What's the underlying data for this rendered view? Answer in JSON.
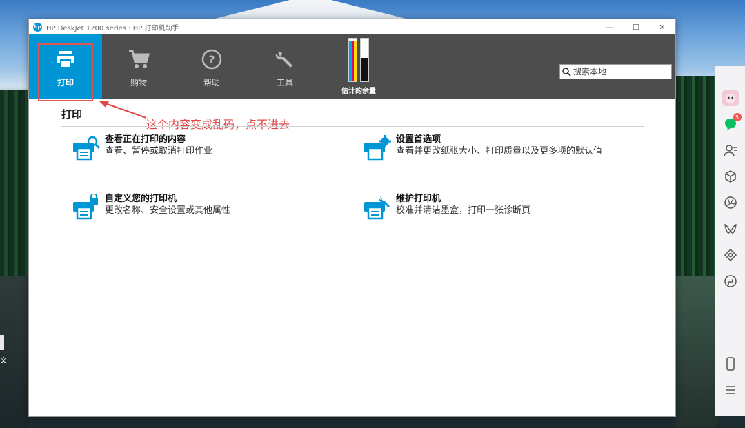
{
  "window": {
    "title": "HP DeskJet 1200 series : HP 打印机助手",
    "logo_text": "hp",
    "controls": {
      "minimize": "—",
      "maximize": "☐",
      "close": "✕"
    }
  },
  "toolbar": {
    "items": [
      {
        "label": "打印",
        "icon": "printer-icon",
        "active": true
      },
      {
        "label": "购物",
        "icon": "cart-icon"
      },
      {
        "label": "帮助",
        "icon": "help-icon"
      },
      {
        "label": "工具",
        "icon": "wrench-icon"
      }
    ],
    "ink": {
      "label": "估计的余量",
      "color_level": 0.95,
      "black_level": 0.55,
      "colors": {
        "cyan": "#00a8e1",
        "magenta": "#e0007a",
        "yellow": "#ffe000",
        "black": "#111111"
      }
    },
    "search": {
      "placeholder": "搜索本地"
    }
  },
  "main": {
    "section_title": "打印",
    "annotation": "这个内容变成乱码，点不进去",
    "actions": [
      {
        "title": "查看正在打印的内容",
        "desc": "查看、暂停或取消打印作业",
        "icon": "print-queue-icon"
      },
      {
        "title": "设置首选项",
        "desc": "查看并更改纸张大小、打印质量以及更多项的默认值",
        "icon": "printer-settings-icon"
      },
      {
        "title": "自定义您的打印机",
        "desc": "更改名称、安全设置或其他属性",
        "icon": "printer-lock-icon"
      },
      {
        "title": "维护打印机",
        "desc": "校准并清洁墨盒，打印一张诊断页",
        "icon": "printer-maintenance-icon"
      }
    ]
  },
  "desktop": {
    "icon_label": "文"
  },
  "sidebar": {
    "badge_count": "5",
    "accent": "#07c160"
  }
}
